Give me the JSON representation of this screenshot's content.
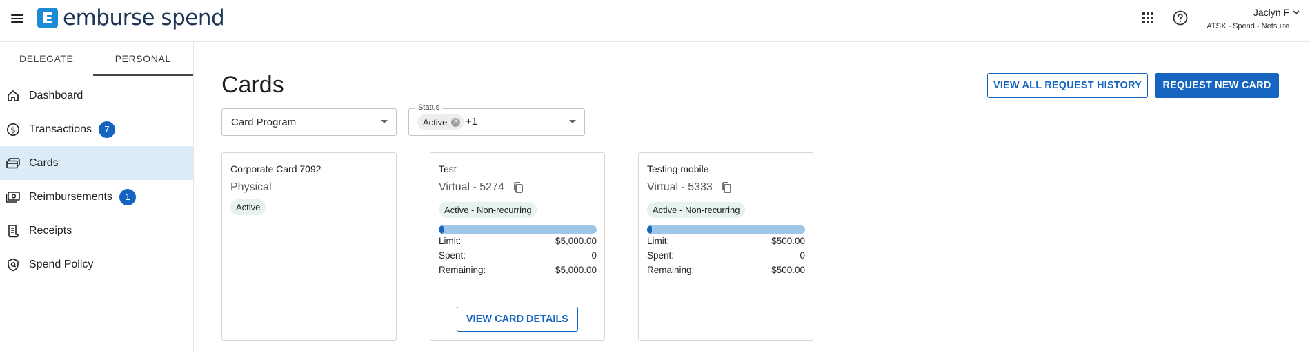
{
  "header": {
    "logo_text": "emburse spend",
    "user_name": "Jaclyn F",
    "user_org": "ATSX - Spend - Netsuite"
  },
  "sidebar": {
    "tabs": [
      {
        "label": "DELEGATE"
      },
      {
        "label": "PERSONAL"
      }
    ],
    "items": [
      {
        "label": "Dashboard",
        "icon": "home-icon"
      },
      {
        "label": "Transactions",
        "icon": "dollar-circle-icon",
        "badge": "7"
      },
      {
        "label": "Cards",
        "icon": "cards-icon"
      },
      {
        "label": "Reimbursements",
        "icon": "money-icon",
        "badge": "1"
      },
      {
        "label": "Receipts",
        "icon": "receipt-icon"
      },
      {
        "label": "Spend Policy",
        "icon": "policy-shield-icon"
      }
    ]
  },
  "main": {
    "title": "Cards",
    "view_history_label": "VIEW ALL REQUEST HISTORY",
    "request_card_label": "REQUEST NEW CARD",
    "filters": {
      "program_value": "Card Program",
      "status_label": "Status",
      "status_chip": "Active",
      "status_more": "+1"
    },
    "cards": [
      {
        "name": "Corporate Card 7092",
        "type": "Physical",
        "status": "Active"
      },
      {
        "name": "Test",
        "type": "Virtual - 5274",
        "status": "Active - Non-recurring",
        "spent_fraction": 0,
        "limit_label": "Limit:",
        "limit": "$5,000.00",
        "spent_label": "Spent:",
        "spent": "0",
        "remaining_label": "Remaining:",
        "remaining": "$5,000.00",
        "details_label": "VIEW CARD DETAILS"
      },
      {
        "name": "Testing mobile",
        "type": "Virtual - 5333",
        "status": "Active - Non-recurring",
        "spent_fraction": 0,
        "limit_label": "Limit:",
        "limit": "$500.00",
        "spent_label": "Spent:",
        "spent": "0",
        "remaining_label": "Remaining:",
        "remaining": "$500.00"
      }
    ]
  },
  "colors": {
    "primary": "#1565c0",
    "selected_nav": "#dcebf8",
    "status_chip_bg": "#e5f3ec",
    "bar_track": "#9fc6e8"
  }
}
